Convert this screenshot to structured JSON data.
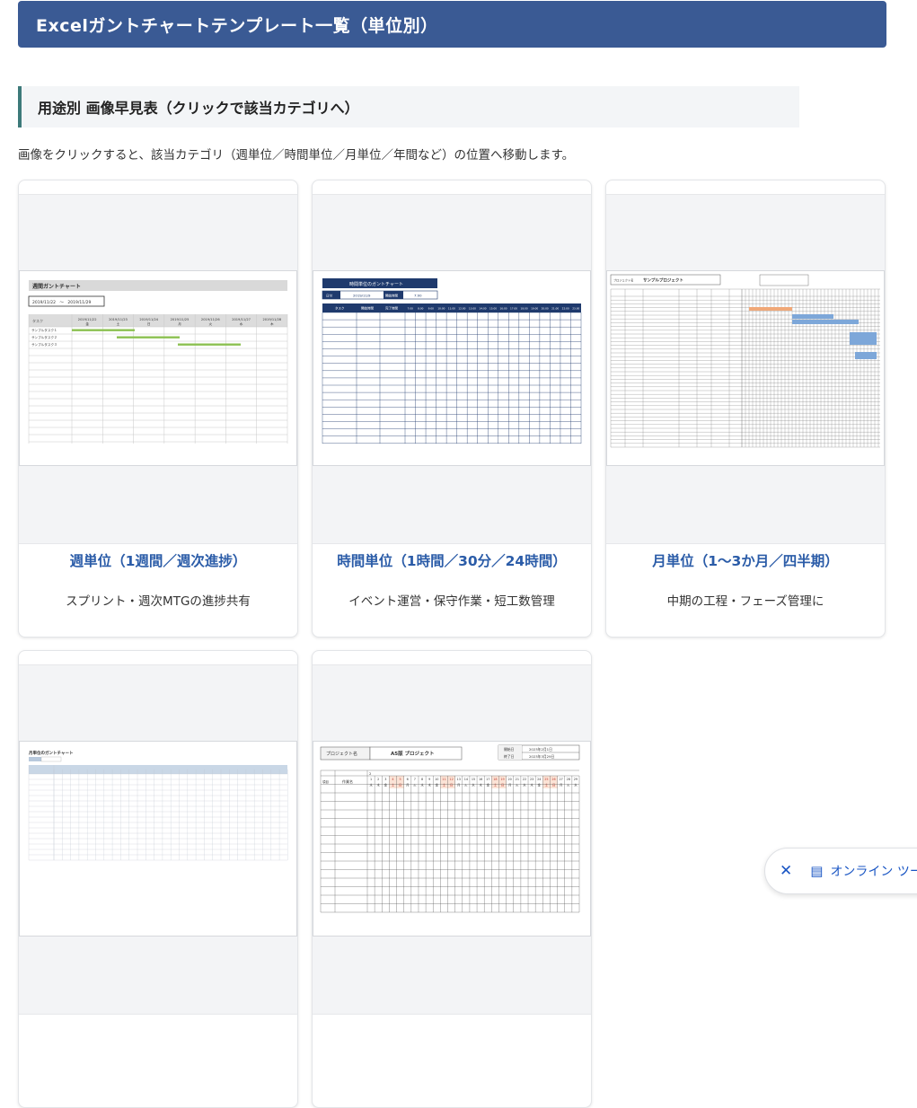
{
  "page": {
    "title": "Excelガントチャートテンプレート一覧（単位別）",
    "section_title": "用途別 画像早見表（クリックで該当カテゴリへ）",
    "description": "画像をクリックすると、該当カテゴリ（週単位／時間単位／月単位／年間など）の位置へ移動します。"
  },
  "cards": [
    {
      "title": "週単位（1週間／週次進捗）",
      "desc": "スプリント・週次MTGの進捗共有",
      "thumb": {
        "heading": "週間ガントチャート",
        "range": "2019/11/22　～　2019/11/29",
        "col_task": "タスク",
        "dates": [
          "2019/11/22",
          "2019/11/23",
          "2019/11/24",
          "2019/11/25",
          "2019/11/26",
          "2019/11/27",
          "2019/11/28"
        ],
        "weekdays": [
          "金",
          "土",
          "日",
          "月",
          "火",
          "水",
          "木"
        ],
        "tasks": [
          "サンプルタスク１",
          "サンプルタスク２",
          "サンプルタスク３"
        ]
      }
    },
    {
      "title": "時間単位（1時間／30分／24時間）",
      "desc": "イベント運営・保守作業・短工数管理",
      "thumb": {
        "heading": "時間単位のガントチャート",
        "date_label": "日付",
        "date_value": "2019/11/9",
        "start_label": "開始時間",
        "start_value": "7:00",
        "cols": [
          "タスク",
          "開始時間",
          "完了時間"
        ],
        "hours": [
          "7:00",
          "8:00",
          "9:00",
          "10:00",
          "11:00",
          "12:00",
          "13:00",
          "14:00",
          "15:00",
          "16:00",
          "17:00",
          "18:00",
          "19:00",
          "20:00",
          "21:00",
          "22:00",
          "23:00"
        ]
      }
    },
    {
      "title": "月単位（1〜3か月／四半期）",
      "desc": "中期の工程・フェーズ管理に",
      "thumb": {
        "project_label": "プロジェクト名",
        "project_name": "サンプルプロジェクト"
      }
    },
    {
      "title": "",
      "desc": "",
      "thumb": {
        "heading": "月単位のガントチャート"
      }
    },
    {
      "title": "",
      "desc": "",
      "thumb": {
        "project_label": "プロジェクト名",
        "project_name": "A5版 プロジェクト",
        "start_label": "開始日",
        "start_value": "2023年2月1日",
        "end_label": "終了日",
        "end_value": "2023年3月29日",
        "col_no": "項目",
        "col_task": "作業名",
        "month": "2",
        "days": [
          "1",
          "2",
          "3",
          "4",
          "5",
          "6",
          "7",
          "8",
          "9",
          "10",
          "11",
          "12",
          "13",
          "14",
          "15",
          "16",
          "17",
          "18",
          "19",
          "20",
          "21",
          "22",
          "23",
          "24",
          "25",
          "26",
          "27",
          "28",
          "29"
        ],
        "weekdays": [
          "水",
          "木",
          "金",
          "土",
          "日",
          "月",
          "火",
          "水",
          "木",
          "金",
          "土",
          "日",
          "月",
          "火",
          "水",
          "木",
          "金",
          "土",
          "日",
          "月",
          "火",
          "水",
          "木",
          "金",
          "土",
          "日",
          "月",
          "火",
          "水"
        ]
      }
    }
  ],
  "popup": {
    "label": "オンライン ツール",
    "close_icon": "close-icon",
    "doc_icon": "document-icon"
  },
  "colors": {
    "banner": "#3a5a94",
    "accent_border": "#3d7a7a",
    "card_title": "#2b5ca8",
    "gantt_bar": "#8cc152",
    "gantt_blue": "#7da7d9",
    "gantt_orange": "#f0a878",
    "sheet_navy": "#1f3a6d"
  }
}
